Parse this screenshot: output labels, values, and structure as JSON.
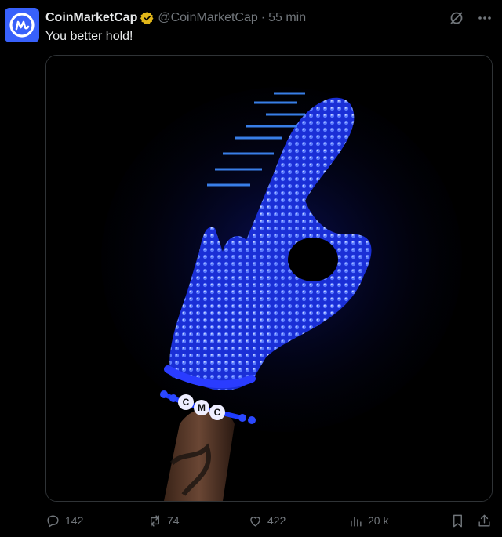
{
  "author": {
    "name": "CoinMarketCap",
    "handle": "@CoinMarketCap",
    "separator": "·",
    "time": "55 min"
  },
  "tweet": {
    "text": "You better hold!"
  },
  "media": {
    "bracelet_letters": [
      "C",
      "M",
      "C"
    ]
  },
  "actions": {
    "replies": "142",
    "reposts": "74",
    "likes": "422",
    "views": "20 k"
  },
  "colors": {
    "brand": "#3861fb",
    "verified": "#e2b719",
    "muted": "#71767b",
    "glove": "#1e3cff"
  }
}
